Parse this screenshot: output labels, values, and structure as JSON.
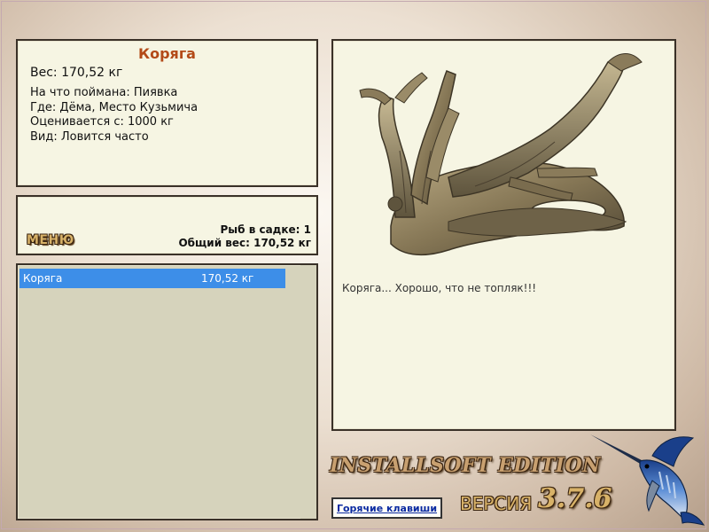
{
  "info": {
    "title": "Коряга",
    "weight": "Вес: 170,52 кг",
    "caught_on": "На что поймана: Пиявка",
    "location": "Где: Дёма, Место Кузьмича",
    "valued_from": "Оценивается с: 1000 кг",
    "kind": "Вид: Ловится часто"
  },
  "menu": {
    "button_label": "МЕНЮ",
    "fish_count": "Рыб в садке: 1",
    "total_weight": "Общий вес: 170,52 кг"
  },
  "catch_list": [
    {
      "name": "Коряга",
      "weight": "170,52 кг",
      "selected": true
    }
  ],
  "picture": {
    "icon": "driftwood-image",
    "description": "Коряга... Хорошо, что не топляк!!!"
  },
  "footer": {
    "edition": "INSTALLSOFT EDITION",
    "hotkeys_label": "Горячие клавиши",
    "version_label": "ВЕРСИЯ",
    "version_number": "3.7.6",
    "logo_icon": "marlin-logo"
  },
  "colors": {
    "panel_bg": "#f6f5e3",
    "list_bg": "#d6d3bc",
    "selection": "#3d8ee8",
    "title": "#b34a18",
    "gold_text": "#d8b268"
  }
}
